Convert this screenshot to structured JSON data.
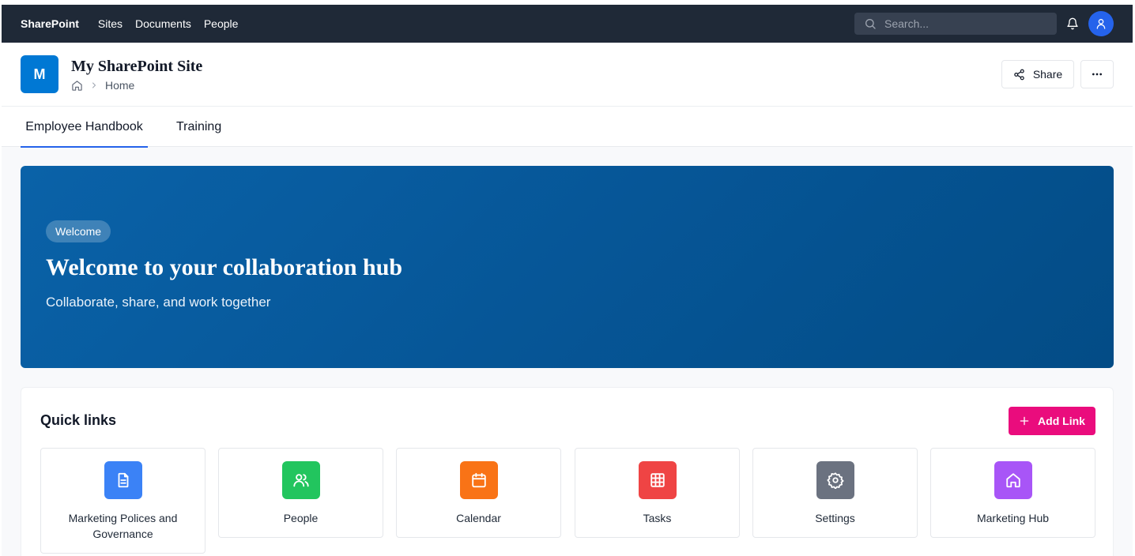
{
  "topnav": {
    "brand": "SharePoint",
    "links": [
      "Sites",
      "Documents",
      "People"
    ],
    "search_placeholder": "Search..."
  },
  "site": {
    "logo_letter": "M",
    "title": "My SharePoint Site",
    "breadcrumb_current": "Home",
    "share_label": "Share"
  },
  "tabs": [
    {
      "label": "Employee Handbook",
      "active": true
    },
    {
      "label": "Training",
      "active": false
    }
  ],
  "hero": {
    "badge": "Welcome",
    "title": "Welcome to your collaboration hub",
    "subtitle": "Collaborate, share, and work together"
  },
  "quick_links": {
    "title": "Quick links",
    "add_label": "Add Link",
    "items": [
      {
        "label": "Marketing Polices and Governance",
        "icon": "document-icon",
        "color": "#3b82f6"
      },
      {
        "label": "People",
        "icon": "users-icon",
        "color": "#22c55e"
      },
      {
        "label": "Calendar",
        "icon": "calendar-icon",
        "color": "#f97316"
      },
      {
        "label": "Tasks",
        "icon": "grid-icon",
        "color": "#ef4444"
      },
      {
        "label": "Settings",
        "icon": "gear-icon",
        "color": "#6b7280"
      },
      {
        "label": "Marketing Hub",
        "icon": "home-icon",
        "color": "#a855f7"
      }
    ]
  },
  "colors": {
    "topnav_bg": "#1f2937",
    "accent": "#2563eb",
    "add_link": "#ea0c7d",
    "hero": "#065697"
  }
}
